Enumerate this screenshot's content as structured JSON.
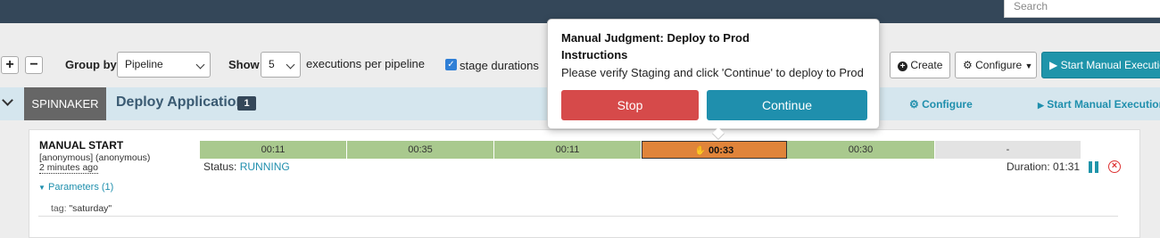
{
  "topbar": {
    "search_placeholder": "Search"
  },
  "controls": {
    "add": "+",
    "remove": "−",
    "group_by_label": "Group by",
    "group_by_value": "Pipeline",
    "show_label": "Show",
    "show_value": "5",
    "executions_label": "executions per pipeline",
    "stage_durations_label": "stage durations",
    "stage_durations_checked": true,
    "create_label": "Create",
    "configure_label": "Configure",
    "start_manual_label": "Start Manual Execution"
  },
  "group": {
    "app": "SPINNAKER",
    "title": "Deploy Application",
    "count": "1",
    "configure_link": "Configure",
    "start_link": "Start Manual Execution"
  },
  "execution": {
    "title": "MANUAL START",
    "user": "[anonymous] (anonymous)",
    "time": "2 minutes ago",
    "status_label": "Status:",
    "status_value": "RUNNING",
    "duration": "Duration: 01:31",
    "stages": [
      {
        "label": "00:11",
        "state": "succeeded"
      },
      {
        "label": "00:35",
        "state": "succeeded"
      },
      {
        "label": "00:11",
        "state": "succeeded"
      },
      {
        "label": "00:33",
        "state": "running"
      },
      {
        "label": "00:30",
        "state": "succeeded"
      },
      {
        "label": "-",
        "state": "not-started"
      }
    ],
    "params_toggle": "Parameters (1)",
    "params": [
      {
        "key": "tag:",
        "value": "\"saturday\""
      }
    ]
  },
  "popover": {
    "title": "Manual Judgment: Deploy to Prod",
    "subtitle": "Instructions",
    "text": "Please verify Staging and click 'Continue' to deploy to Prod",
    "stop_label": "Stop",
    "continue_label": "Continue"
  },
  "colors": {
    "topbar": "#344759",
    "stage_succeeded": "#a9c98e",
    "stage_running": "#e0843a",
    "primary": "#1f94aa",
    "danger": "#d64a4a"
  }
}
